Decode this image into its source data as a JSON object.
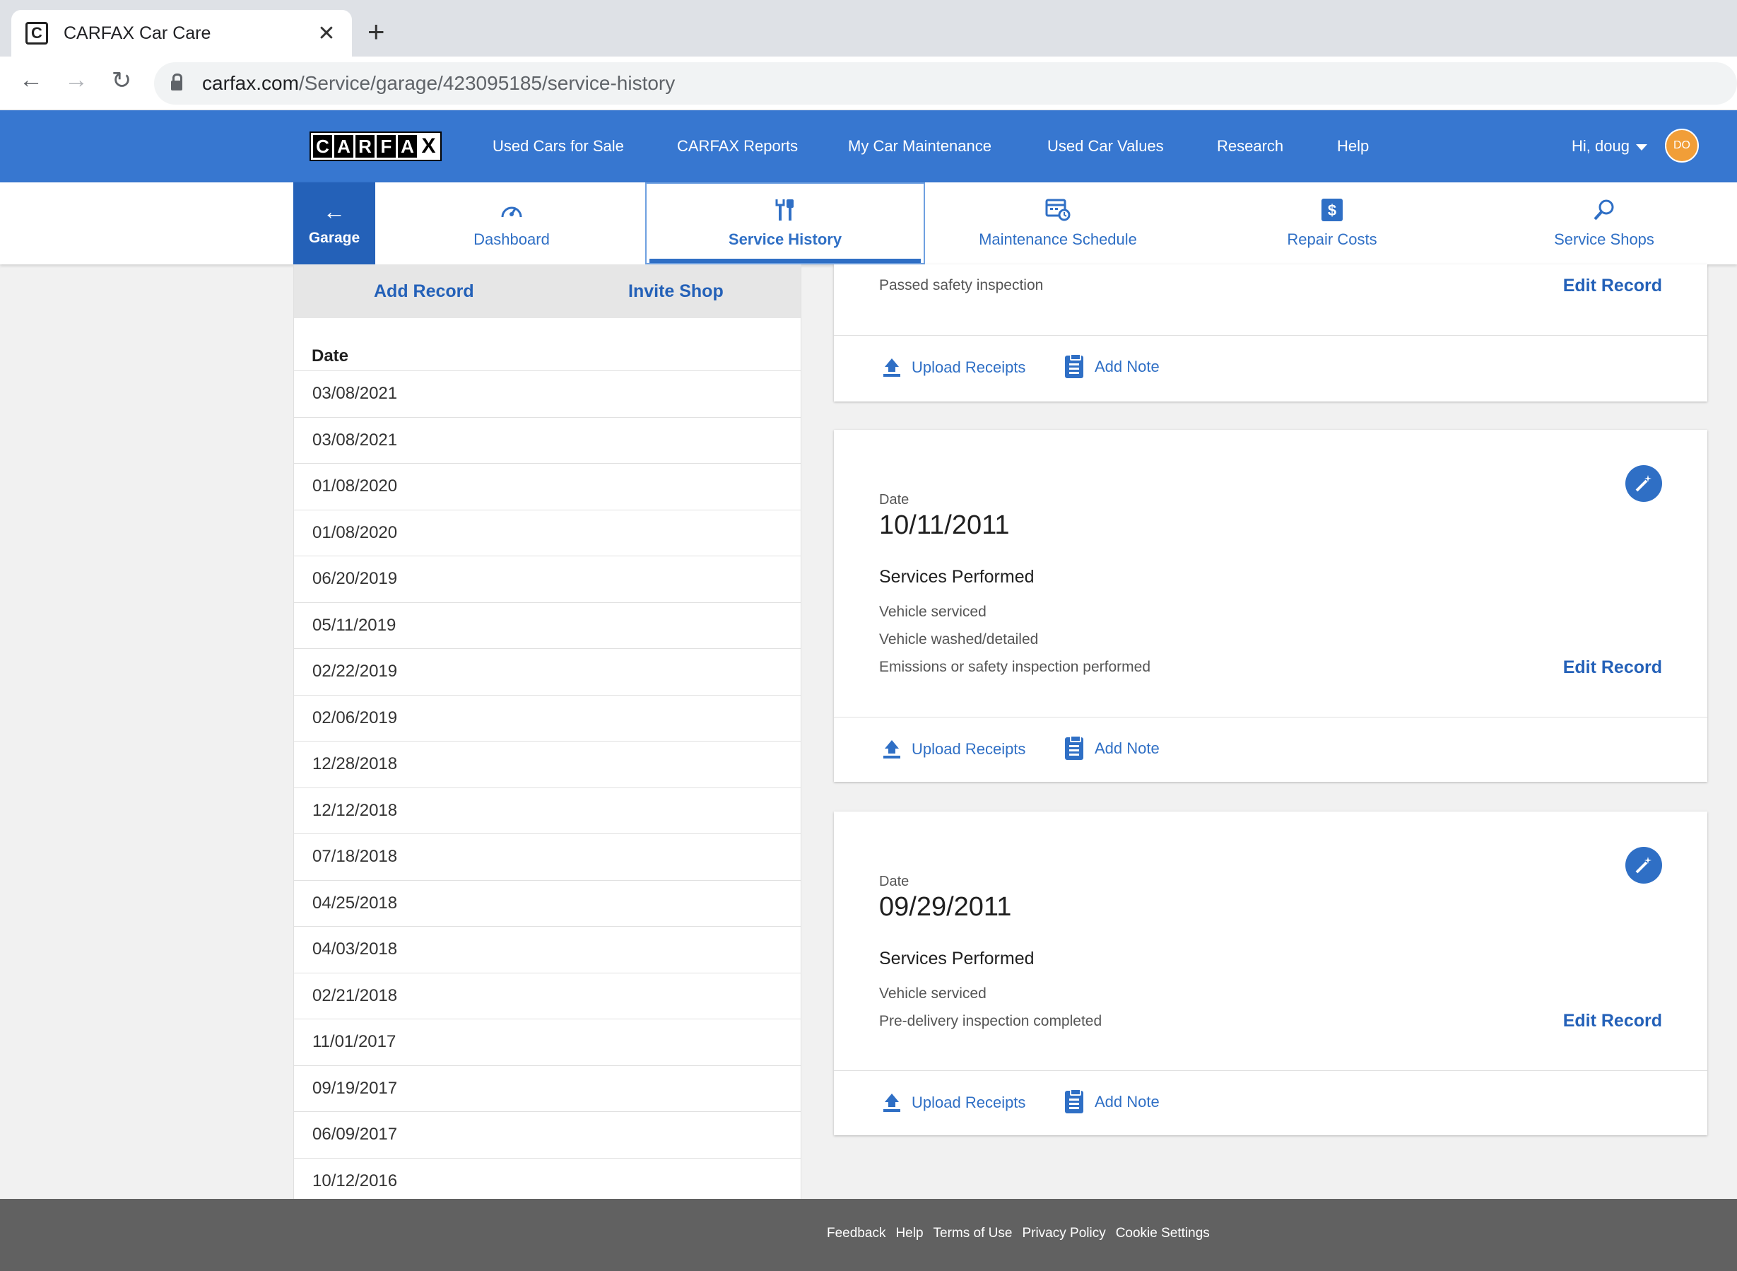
{
  "browser": {
    "tab_title": "CARFAX Car Care",
    "favicon_letter": "C",
    "close_glyph": "✕",
    "new_tab_glyph": "+",
    "url_domain": "carfax.com",
    "url_path": "/Service/garage/423095185/service-history"
  },
  "header": {
    "logo_letters": [
      "C",
      "A",
      "R",
      "F",
      "A",
      "X"
    ],
    "nav": [
      "Used Cars for Sale",
      "CARFAX Reports",
      "My Car Maintenance",
      "Used Car Values",
      "Research",
      "Help"
    ],
    "greeting": "Hi, doug",
    "avatar_initials": "DO",
    "brand_color": "#3777d0"
  },
  "subnav": {
    "garage_label": "Garage",
    "tabs": [
      {
        "label": "Dashboard",
        "icon": "speedometer-icon"
      },
      {
        "label": "Service History",
        "icon": "wrench-icon"
      },
      {
        "label": "Maintenance Schedule",
        "icon": "calendar-clock-icon"
      },
      {
        "label": "Repair Costs",
        "icon": "dollar-icon"
      },
      {
        "label": "Service Shops",
        "icon": "search-icon"
      }
    ],
    "active_tab": "Service History"
  },
  "left_panel": {
    "add_record": "Add Record",
    "invite_shop": "Invite Shop",
    "date_header": "Date",
    "dates": [
      "03/08/2021",
      "03/08/2021",
      "01/08/2020",
      "01/08/2020",
      "06/20/2019",
      "05/11/2019",
      "02/22/2019",
      "02/06/2019",
      "12/28/2018",
      "12/12/2018",
      "07/18/2018",
      "04/25/2018",
      "04/03/2018",
      "02/21/2018",
      "11/01/2017",
      "09/19/2017",
      "06/09/2017",
      "10/12/2016"
    ]
  },
  "cards": [
    {
      "partial_service": "Passed safety inspection",
      "edit": "Edit Record",
      "upload": "Upload Receipts",
      "note": "Add Note"
    },
    {
      "date_label": "Date",
      "date": "10/11/2011",
      "services_title": "Services Performed",
      "services": [
        "Vehicle serviced",
        "Vehicle washed/detailed",
        "Emissions or safety inspection performed"
      ],
      "edit": "Edit Record",
      "upload": "Upload Receipts",
      "note": "Add Note"
    },
    {
      "date_label": "Date",
      "date": "09/29/2011",
      "services_title": "Services Performed",
      "services": [
        "Vehicle serviced",
        "Pre-delivery inspection completed"
      ],
      "edit": "Edit Record",
      "upload": "Upload Receipts",
      "note": "Add Note"
    }
  ],
  "footer": {
    "links": [
      "Feedback",
      "Help",
      "Terms of Use",
      "Privacy Policy",
      "Cookie Settings"
    ]
  }
}
